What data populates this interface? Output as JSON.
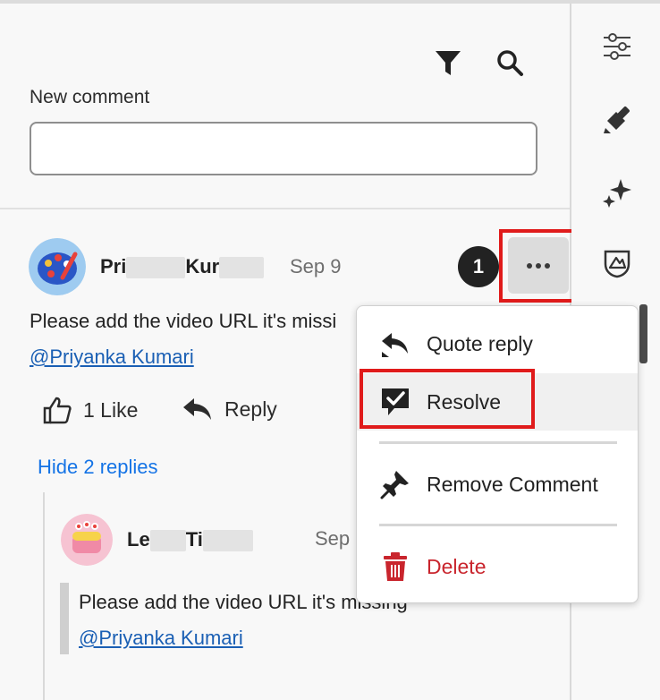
{
  "toolbar": {
    "filter_icon": "filter-icon",
    "search_icon": "search-icon"
  },
  "new_comment": {
    "label": "New comment",
    "value": ""
  },
  "comment": {
    "author_first": "Pri",
    "author_last": "Kur",
    "date": "Sep 9",
    "badge": "1",
    "text": "Please add the video URL it's missi",
    "mention": "@Priyanka Kumari",
    "like_label": "1 Like",
    "reply_label": "Reply",
    "hide_replies": "Hide 2 replies"
  },
  "reply": {
    "author_first": "Le",
    "author_last": "Ti",
    "date": "Sep",
    "text": "Please add the video URL it",
    "text_tail": "s missing",
    "mention": "@Priyanka Kumari"
  },
  "menu": {
    "quote_reply": "Quote reply",
    "resolve": "Resolve",
    "remove_comment": "Remove Comment",
    "delete": "Delete"
  },
  "colors": {
    "highlight": "#e01b1b",
    "link": "#1473e6",
    "danger": "#c9252d"
  }
}
